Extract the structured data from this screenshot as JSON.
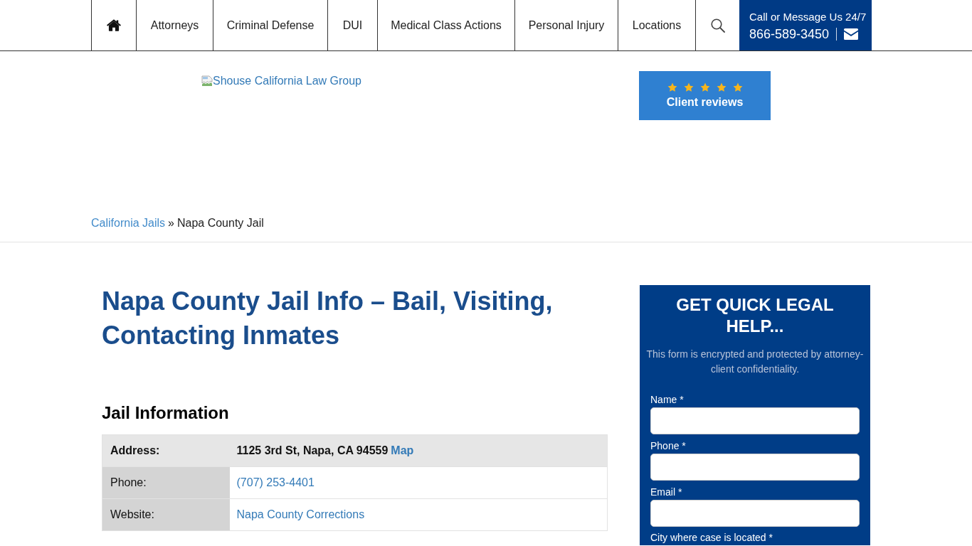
{
  "nav": {
    "items": [
      {
        "kind": "home"
      },
      {
        "kind": "link",
        "label": "Attorneys"
      },
      {
        "kind": "link",
        "label": "Criminal Defense"
      },
      {
        "kind": "link",
        "label": "DUI"
      },
      {
        "kind": "link",
        "label": "Medical Class Actions"
      },
      {
        "kind": "link",
        "label": "Personal Injury"
      },
      {
        "kind": "link",
        "label": "Locations"
      },
      {
        "kind": "search"
      }
    ],
    "contact": {
      "label": "Call or Message Us 24/7",
      "phone": "866-589-3450"
    }
  },
  "logo": {
    "alt": "Shouse California Law Group"
  },
  "reviews": {
    "stars": 5,
    "label": "Client reviews"
  },
  "breadcrumb": {
    "items": [
      {
        "label": "California Jails",
        "link": true
      },
      {
        "label": "Napa County Jail",
        "link": false
      }
    ],
    "separator": "»"
  },
  "heading": "Napa County Jail Info – Bail, Visiting, Contacting Inmates",
  "section_title": "Jail Information",
  "info_table": {
    "rows": [
      {
        "kind": "header",
        "label": "Address:",
        "value": "1125 3rd St, Napa, CA 94559",
        "link": "Map"
      },
      {
        "kind": "row",
        "label": "Phone:",
        "link": "(707) 253-4401"
      },
      {
        "kind": "row",
        "label": "Website:",
        "link": "Napa County Corrections"
      }
    ]
  },
  "form": {
    "title": "GET QUICK LEGAL HELP...",
    "note": "This form is encrypted and protected by attorney-client confidentiality.",
    "fields": [
      {
        "kind": "text",
        "label": "Name *"
      },
      {
        "kind": "text",
        "label": "Phone *"
      },
      {
        "kind": "text",
        "label": "Email *"
      },
      {
        "kind": "label_only",
        "label": "City where case is located *"
      }
    ]
  }
}
